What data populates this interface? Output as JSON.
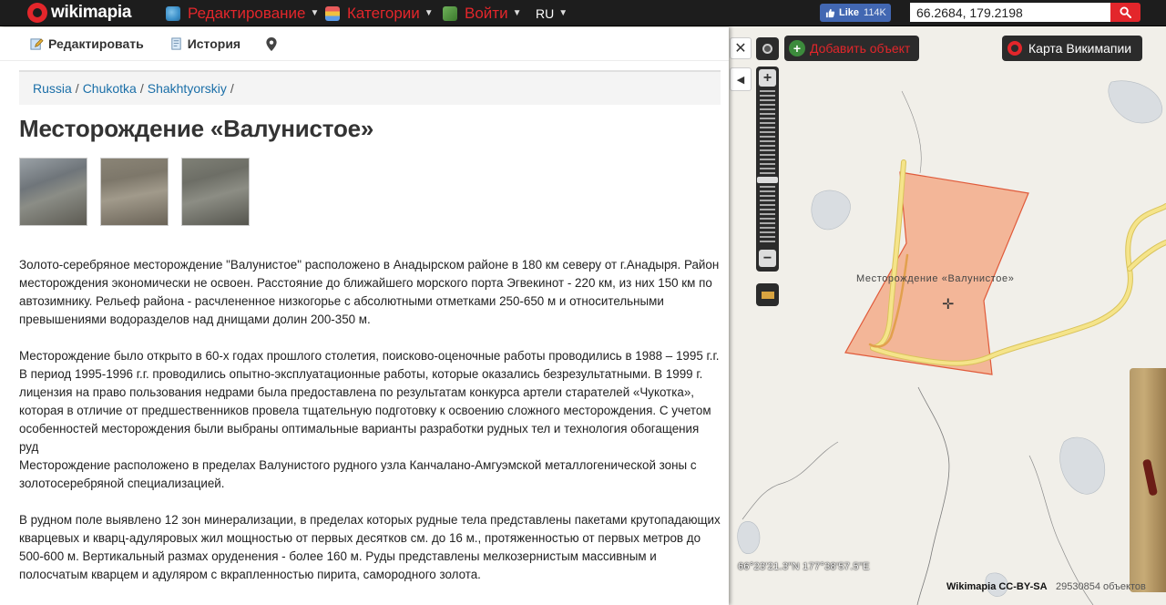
{
  "topbar": {
    "logo_text": "wikimapia",
    "menu": [
      {
        "label": "Редактирование",
        "icon": "edit-globe-icon"
      },
      {
        "label": "Категории",
        "icon": "categories-icon"
      },
      {
        "label": "Войти",
        "icon": "login-icon"
      }
    ],
    "language": "RU",
    "fb_like": {
      "label": "Like",
      "count": "114K"
    },
    "search": {
      "value": "66.2684, 179.2198"
    }
  },
  "panel": {
    "tabs": [
      {
        "label": "Редактировать",
        "icon": "pencil-icon"
      },
      {
        "label": "История",
        "icon": "history-icon"
      },
      {
        "label": "",
        "icon": "location-pin-icon"
      }
    ],
    "breadcrumb": [
      "Russia",
      "Chukotka",
      "Shakhtyorskiy"
    ],
    "breadcrumb_sep": "/",
    "title": "Месторождение «Валунистое»",
    "photos_count": 3,
    "description": [
      "Золото-серебряное месторождение \"Валунистое\" расположено в Анадырском районе в 180 км северу от г.Анадыря. Район месторождения экономически не освоен. Расстояние до ближайшего морского порта Эгвекинот - 220 км, из них 150 км по автозимнику. Рельеф района - расчлененное низкогорье с абсолютными отметками 250-650 м и относительными превышениями водоразделов над днищами долин 200-350 м.",
      "Месторождение было открыто в 60-х годах прошлого столетия, поисково-оценочные работы проводились в 1988 – 1995 г.г. В период 1995-1996 г.г. проводились опытно-эксплуатационные работы, которые оказались безрезультатными. В 1999 г. лицензия на право пользования недрами была предоставлена по результатам конкурса артели старателей «Чукотка», которая в отличие от предшественников провела тщательную подготовку к освоению сложного месторождения. С учетом особенностей месторождения были выбраны оптимальные варианты разработки рудных тел и технология обогащения руд\nМесторождение расположено в пределах Валунистого рудного узла Канчалано-Амгуэмской металлогенической зоны с золотосеребряной специализацией.",
      "В рудном поле выявлено 12 зон минерализации, в пределах которых рудные тела представлены пакетами крутопадающих кварцевых и кварц-адуляровых жил мощностью от первых десятков см. до 16 м., протяженностью от первых метров до 500-600 м. Вертикальный размах оруденения - более 160 м. Руды представлены мелкозернистым массивным и полосчатым кварцем и адуляром с вкрапленностью пирита, самородного золота."
    ]
  },
  "map": {
    "close_glyph": "✕",
    "collapse_glyph": "◀",
    "add_object_label": "Добавить объект",
    "wikimapia_map_label": "Карта Викимапии",
    "zoom_in": "+",
    "zoom_out": "−",
    "feature_label": "Месторождение «Валунистое»",
    "coords_readout": "66°23'21.3\"N 177°38'57.5\"E",
    "attribution": "Wikimapia CC-BY-SA",
    "object_count": "29530854 объектов",
    "colors": {
      "polygon_fill": "#f4a582",
      "polygon_stroke": "#e05a3a",
      "road": "#f5e48a",
      "road_edge": "#d9c35a",
      "water": "#d9dde1",
      "accent": "#e3262b"
    }
  }
}
